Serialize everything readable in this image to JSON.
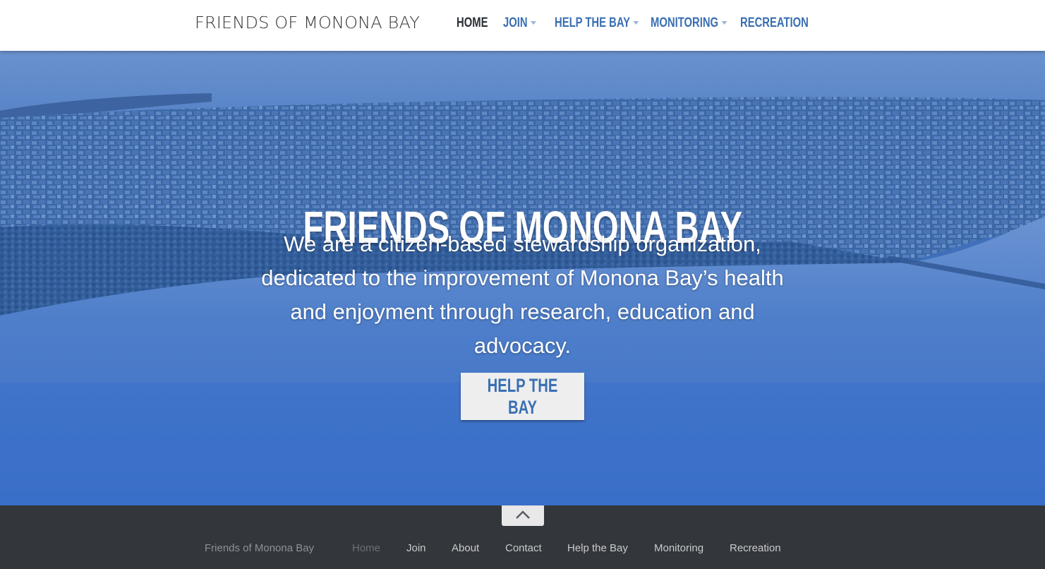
{
  "nav": {
    "brand": "FRIENDS OF MONONA BAY",
    "items": [
      {
        "label": "HOME",
        "active": true,
        "dropdown": false
      },
      {
        "label": "JOIN",
        "active": false,
        "dropdown": true
      },
      {
        "label": "HELP THE BAY",
        "active": false,
        "dropdown": true
      },
      {
        "label": "MONITORING",
        "active": false,
        "dropdown": true
      },
      {
        "label": "RECREATION",
        "active": false,
        "dropdown": false
      }
    ]
  },
  "hero": {
    "title": "FRIENDS OF MONONA BAY",
    "text": "We are a citizen-based stewardship organization, dedicated to the improvement of Monona Bay’s health and enjoyment through research, education and advocacy.",
    "button_label": "HELP THE BAY"
  },
  "footer": {
    "brand": "Friends of Monona Bay",
    "links": [
      {
        "label": "Home",
        "active": true
      },
      {
        "label": "Join",
        "active": false
      },
      {
        "label": "About",
        "active": false
      },
      {
        "label": "Contact",
        "active": false
      },
      {
        "label": "Help the Bay",
        "active": false
      },
      {
        "label": "Monitoring",
        "active": false
      },
      {
        "label": "Recreation",
        "active": false
      }
    ],
    "scroll_top_icon": "chevron-up-icon"
  },
  "colors": {
    "nav_link": "#3a6fb3",
    "nav_active": "#2b2f36",
    "hero_tint": "#3f6fba",
    "footer_bg": "#33363b",
    "button_bg": "#eeeeee"
  }
}
